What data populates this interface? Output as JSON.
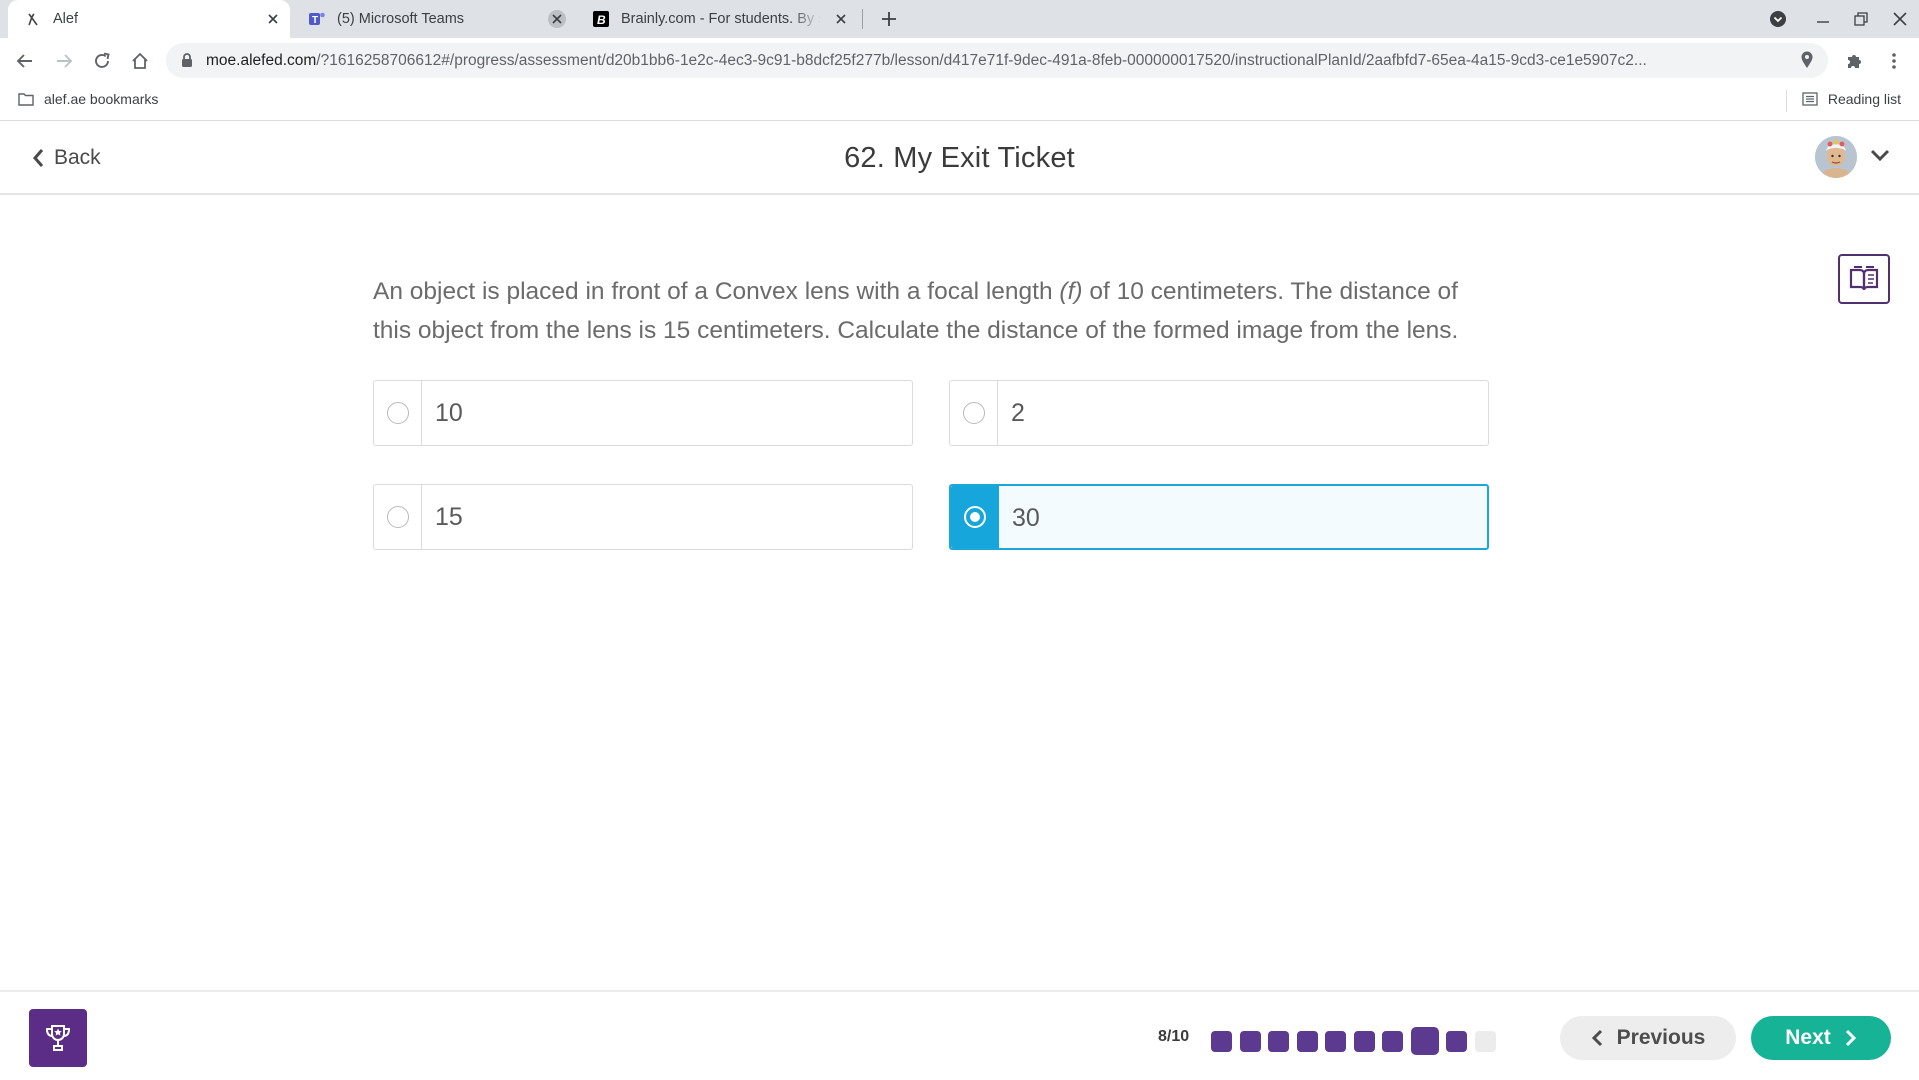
{
  "browser": {
    "tabs": [
      {
        "title": "Alef",
        "icon": "alef-icon",
        "active": true
      },
      {
        "title": "(5) Microsoft Teams",
        "icon": "teams-icon",
        "active": false
      },
      {
        "title": "Brainly.com - For students. By students",
        "icon": "brainly-icon",
        "active": false
      }
    ],
    "url_host": "moe.alefed.com",
    "url_rest": "/?1616258706612#/progress/assessment/d20b1bb6-1e2c-4ec3-9c91-b8dcf25f277b/lesson/d417e71f-9dec-491a-8feb-000000017520/instructionalPlanId/2aafbfd7-65ea-4a15-9cd3-ce1e5907c2...",
    "bookmark_folder": "alef.ae bookmarks",
    "reading_list": "Reading list"
  },
  "header": {
    "back_label": "Back",
    "title": "62. My Exit Ticket"
  },
  "question": {
    "text_before": "An object is placed in front of a Convex lens with a focal length ",
    "text_italic": "(f)",
    "text_after": " of 10 centimeters. The distance of this object from the lens is 15 centimeters. Calculate the distance of the formed image from the lens.",
    "options": [
      {
        "label": "10",
        "selected": false
      },
      {
        "label": "2",
        "selected": false
      },
      {
        "label": "15",
        "selected": false
      },
      {
        "label": "30",
        "selected": true
      }
    ]
  },
  "footer": {
    "progress_text": "8/10",
    "current_question": 8,
    "total_questions": 10,
    "answered": 9,
    "previous_label": "Previous",
    "next_label": "Next"
  },
  "colors": {
    "brand_purple": "#5b2d86",
    "selected_blue": "#16a6db",
    "next_green": "#16b397"
  }
}
